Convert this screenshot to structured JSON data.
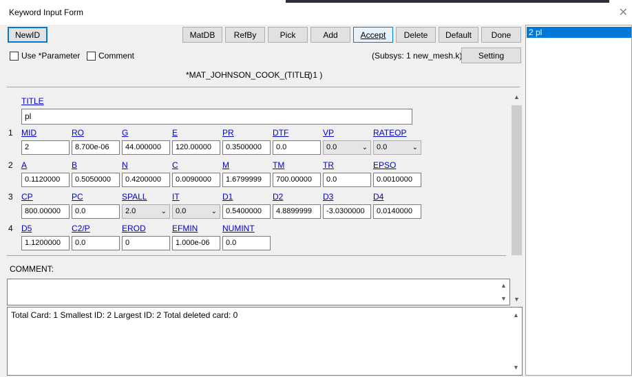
{
  "window": {
    "title": "Keyword Input Form"
  },
  "toolbar": {
    "newid": "NewID",
    "buttons": [
      "MatDB",
      "RefBy",
      "Pick",
      "Add",
      "Accept",
      "Delete",
      "Default",
      "Done"
    ],
    "setting": "Setting"
  },
  "options": {
    "use_parameter": "Use *Parameter",
    "comment": "Comment",
    "subsys": "(Subsys: 1 new_mesh.k)"
  },
  "keyword": {
    "title": "*MAT_JOHNSON_COOK_(TITLE)",
    "count": "( 1 )"
  },
  "title_field": {
    "label": "TITLE",
    "value": "pl"
  },
  "cards": [
    {
      "num": "1",
      "fields": [
        {
          "label": "MID",
          "value": "2",
          "type": "input"
        },
        {
          "label": "RO",
          "value": "8.700e-06",
          "type": "input"
        },
        {
          "label": "G",
          "value": "44.000000",
          "type": "input"
        },
        {
          "label": "E",
          "value": "120.00000",
          "type": "input"
        },
        {
          "label": "PR",
          "value": "0.3500000",
          "type": "input"
        },
        {
          "label": "DTF",
          "value": "0.0",
          "type": "input"
        },
        {
          "label": "VP",
          "value": "0.0",
          "type": "select"
        },
        {
          "label": "RATEOP",
          "value": "0.0",
          "type": "select"
        }
      ]
    },
    {
      "num": "2",
      "fields": [
        {
          "label": "A",
          "value": "0.1120000",
          "type": "input"
        },
        {
          "label": "B",
          "value": "0.5050000",
          "type": "input"
        },
        {
          "label": "N",
          "value": "0.4200000",
          "type": "input"
        },
        {
          "label": "C",
          "value": "0.0090000",
          "type": "input"
        },
        {
          "label": "M",
          "value": "1.6799999",
          "type": "input"
        },
        {
          "label": "TM",
          "value": "700.00000",
          "type": "input"
        },
        {
          "label": "TR",
          "value": "0.0",
          "type": "input"
        },
        {
          "label": "EPSO",
          "value": "0.0010000",
          "type": "input"
        }
      ]
    },
    {
      "num": "3",
      "fields": [
        {
          "label": "CP",
          "value": "800.00000",
          "type": "input"
        },
        {
          "label": "PC",
          "value": "0.0",
          "type": "input"
        },
        {
          "label": "SPALL",
          "value": "2.0",
          "type": "select"
        },
        {
          "label": "IT",
          "value": "0.0",
          "type": "select"
        },
        {
          "label": "D1",
          "value": "0.5400000",
          "type": "input"
        },
        {
          "label": "D2",
          "value": "4.8899999",
          "type": "input"
        },
        {
          "label": "D3",
          "value": "-3.0300000",
          "type": "input"
        },
        {
          "label": "D4",
          "value": "0.0140000",
          "type": "input"
        }
      ]
    },
    {
      "num": "4",
      "fields": [
        {
          "label": "D5",
          "value": "1.1200000",
          "type": "input"
        },
        {
          "label": "C2/P",
          "value": "0.0",
          "type": "input"
        },
        {
          "label": "EROD",
          "value": "0",
          "type": "input"
        },
        {
          "label": "EFMIN",
          "value": "1.000e-06",
          "type": "input"
        },
        {
          "label": "NUMINT",
          "value": "0.0",
          "type": "input"
        }
      ]
    }
  ],
  "comment_label": "COMMENT:",
  "status": "Total Card: 1   Smallest ID: 2   Largest ID: 2   Total deleted card:  0",
  "list": {
    "selected": "2   pl"
  }
}
